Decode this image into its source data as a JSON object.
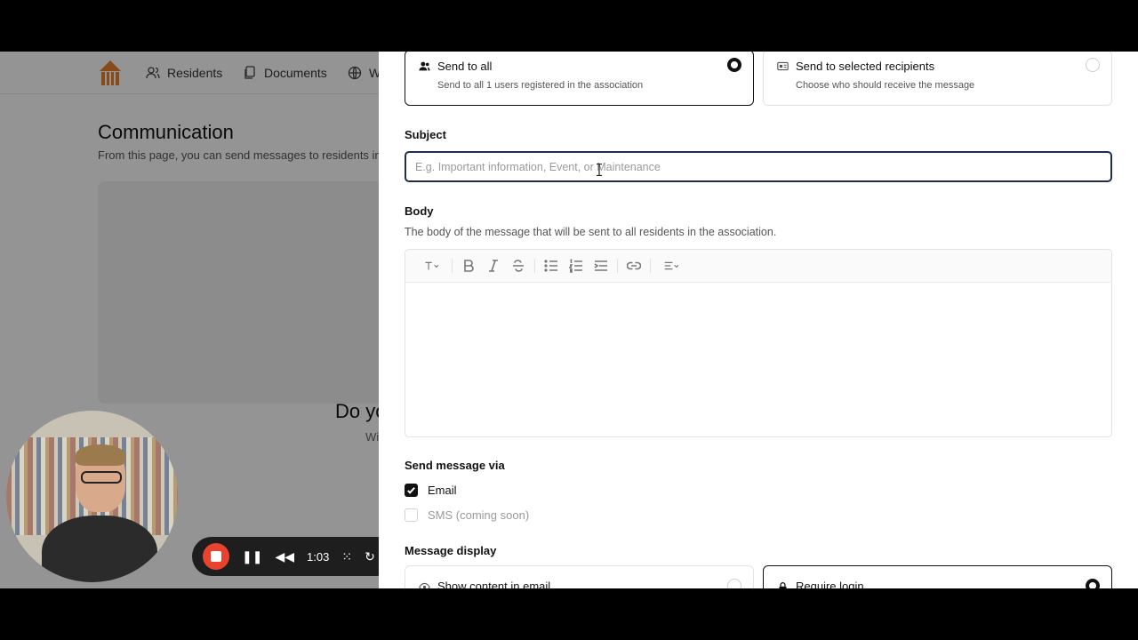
{
  "nav": {
    "items": [
      {
        "label": "Residents",
        "icon": "users-icon"
      },
      {
        "label": "Documents",
        "icon": "documents-icon"
      },
      {
        "label": "W",
        "icon": "globe-icon"
      }
    ]
  },
  "background": {
    "title": "Communication",
    "subtitle": "From this page, you can send messages to residents in",
    "empty_title": "Do yo",
    "empty_sub": "Wi"
  },
  "recorder": {
    "time": "1:03"
  },
  "drawer": {
    "recipients": {
      "all": {
        "title": "Send to all",
        "desc": "Send to all 1 users registered in the association",
        "selected": true
      },
      "selected": {
        "title": "Send to selected recipients",
        "desc": "Choose who should receive the message",
        "selected": false
      }
    },
    "subject": {
      "label": "Subject",
      "placeholder": "E.g. Important information, Event, or Maintenance",
      "value": ""
    },
    "body": {
      "label": "Body",
      "help": "The body of the message that will be sent to all residents in the association."
    },
    "send_via": {
      "label": "Send message via",
      "email": {
        "label": "Email",
        "checked": true
      },
      "sms": {
        "label": "SMS (coming soon)",
        "checked": false
      }
    },
    "display": {
      "label": "Message display",
      "show_content": {
        "label": "Show content in email",
        "selected": false
      },
      "require_login": {
        "label": "Require login",
        "selected": true
      }
    }
  },
  "colors": {
    "accent": "#1f2d52",
    "brand": "#e8802a",
    "record": "#e8432f"
  }
}
